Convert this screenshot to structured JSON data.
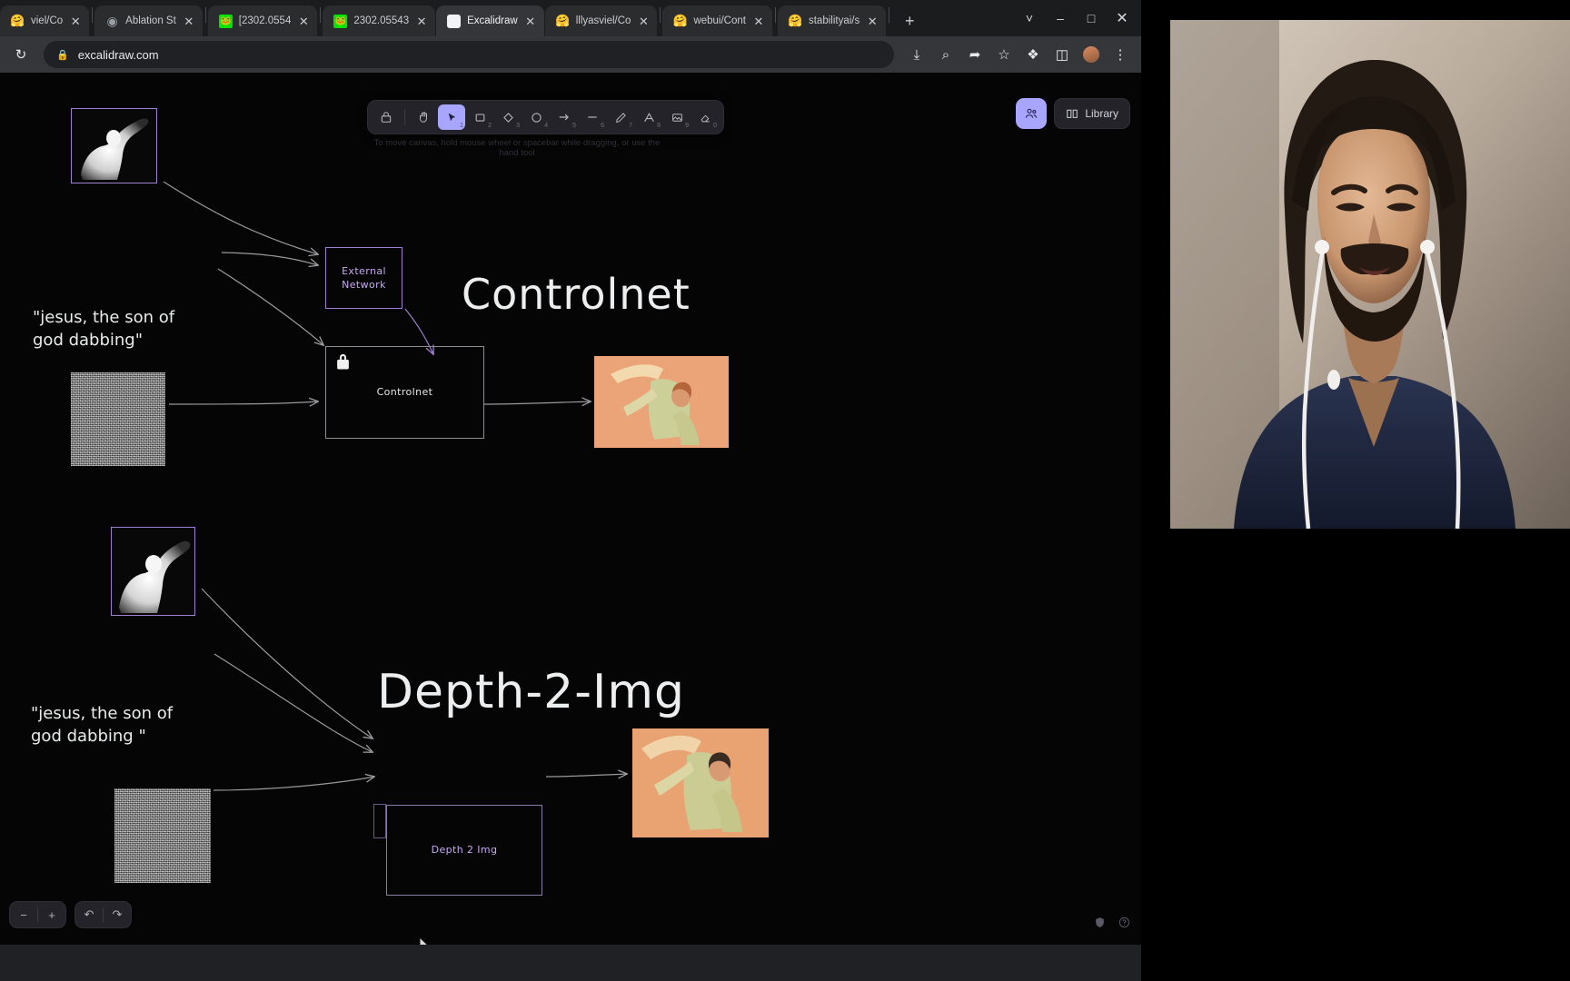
{
  "browser": {
    "tabs": [
      {
        "label": "viel/Co",
        "favicon": "hf-icon",
        "active": false
      },
      {
        "label": "Ablation St",
        "favicon": "github-icon",
        "active": false
      },
      {
        "label": "[2302.0554",
        "favicon": "arxiv-icon",
        "active": false
      },
      {
        "label": "2302.05543",
        "favicon": "arxiv-icon",
        "active": false
      },
      {
        "label": "Excalidraw",
        "favicon": "excalidraw-icon",
        "active": true
      },
      {
        "label": "lllyasviel/Co",
        "favicon": "hf-icon",
        "active": false
      },
      {
        "label": "webui/Cont",
        "favicon": "hf-icon",
        "active": false
      },
      {
        "label": "stabilityai/s",
        "favicon": "hf-icon",
        "active": false
      }
    ],
    "new_tab_label": "+",
    "tab_close_label": "✕",
    "tab_list_label": "˅",
    "window_controls": {
      "minimize": "–",
      "maximize": "□",
      "close": "✕"
    },
    "reload_label": "↻",
    "url": "excalidraw.com",
    "lock_label": "🔒",
    "actions": [
      {
        "name": "install-icon",
        "glyph": "⤓"
      },
      {
        "name": "zoom-icon",
        "glyph": "⌕"
      },
      {
        "name": "share-icon",
        "glyph": "➦"
      },
      {
        "name": "bookmark-star-icon",
        "glyph": "☆"
      },
      {
        "name": "extensions-puzzle-icon",
        "glyph": "❖"
      },
      {
        "name": "sidepanel-icon",
        "glyph": "◫"
      }
    ],
    "menu_label": "⋮"
  },
  "excalidraw": {
    "toolbar": {
      "lock_tool": {
        "name": "lock-tool",
        "glyph": "⚿",
        "shortcut": ""
      },
      "hand_tool": {
        "name": "hand-tool",
        "glyph": "✋",
        "shortcut": ""
      },
      "tools": [
        {
          "name": "selection-tool",
          "glyph": "➤",
          "shortcut": "1",
          "active": true
        },
        {
          "name": "rectangle-tool",
          "glyph": "□",
          "shortcut": "2",
          "active": false
        },
        {
          "name": "diamond-tool",
          "glyph": "◇",
          "shortcut": "3",
          "active": false
        },
        {
          "name": "ellipse-tool",
          "glyph": "○",
          "shortcut": "4",
          "active": false
        },
        {
          "name": "arrow-tool",
          "glyph": "→",
          "shortcut": "5",
          "active": false
        },
        {
          "name": "line-tool",
          "glyph": "─",
          "shortcut": "6",
          "active": false
        },
        {
          "name": "draw-tool",
          "glyph": "✎",
          "shortcut": "7",
          "active": false
        },
        {
          "name": "text-tool",
          "glyph": "A",
          "shortcut": "8",
          "active": false
        },
        {
          "name": "image-tool",
          "glyph": "⛰",
          "shortcut": "9",
          "active": false
        },
        {
          "name": "eraser-tool",
          "glyph": "⌫",
          "shortcut": "0",
          "active": false
        }
      ]
    },
    "hint": "To move canvas, hold mouse wheel or spacebar while dragging, or use the hand tool",
    "share_button": {
      "label": "",
      "icon": "share-people-icon",
      "glyph": "⛭"
    },
    "library_button": {
      "label": "Library",
      "icon": "book-icon",
      "glyph": "◫"
    },
    "zoom_controls": {
      "zoom_out": "−",
      "zoom_reset": "",
      "zoom_in": "+",
      "undo": "↶",
      "redo": "↷"
    },
    "status_icons": [
      {
        "name": "shield-icon",
        "glyph": "⛨"
      },
      {
        "name": "help-icon",
        "glyph": "ⓘ"
      }
    ]
  },
  "diagram": {
    "sections": [
      {
        "title": "Controlnet",
        "prompt": "\"jesus, the son of\n god dabbing\"",
        "nodes": [
          {
            "name": "external-network-node",
            "label": "External\nNetwork",
            "color": "#c9a7f5"
          },
          {
            "name": "controlnet-node",
            "label": "Controlnet",
            "color": "#e6e7e9",
            "locked": true
          }
        ],
        "images": [
          {
            "name": "depth-map-input-image",
            "alt": "grayscale depth map of person dabbing"
          },
          {
            "name": "noise-input-image",
            "alt": "gaussian noise square"
          },
          {
            "name": "generated-output-image",
            "alt": "orange painting of figure dabbing"
          }
        ]
      },
      {
        "title": "Depth-2-Img",
        "prompt": "\"jesus, the son of\ngod dabbing \"",
        "nodes": [
          {
            "name": "depth-2-img-node",
            "label": "Depth 2 Img",
            "color": "#c9a7f5",
            "locked": false
          }
        ],
        "images": [
          {
            "name": "depth-map-input-image",
            "alt": "grayscale depth map of person dabbing"
          },
          {
            "name": "noise-input-image",
            "alt": "gaussian noise square"
          },
          {
            "name": "generated-output-image",
            "alt": "orange painting of figure dabbing"
          }
        ]
      }
    ]
  },
  "webcam": {
    "name": "presenter-webcam",
    "alt": "man with long dark hair and beard wearing navy v-neck shirt and white earbuds"
  },
  "colors": {
    "accent_purple": "#a8a5ff",
    "node_purple": "#c9a7f5",
    "canvas_bg": "#050505",
    "browser_chrome": "#35363a",
    "output_orange": "#e9a373"
  }
}
